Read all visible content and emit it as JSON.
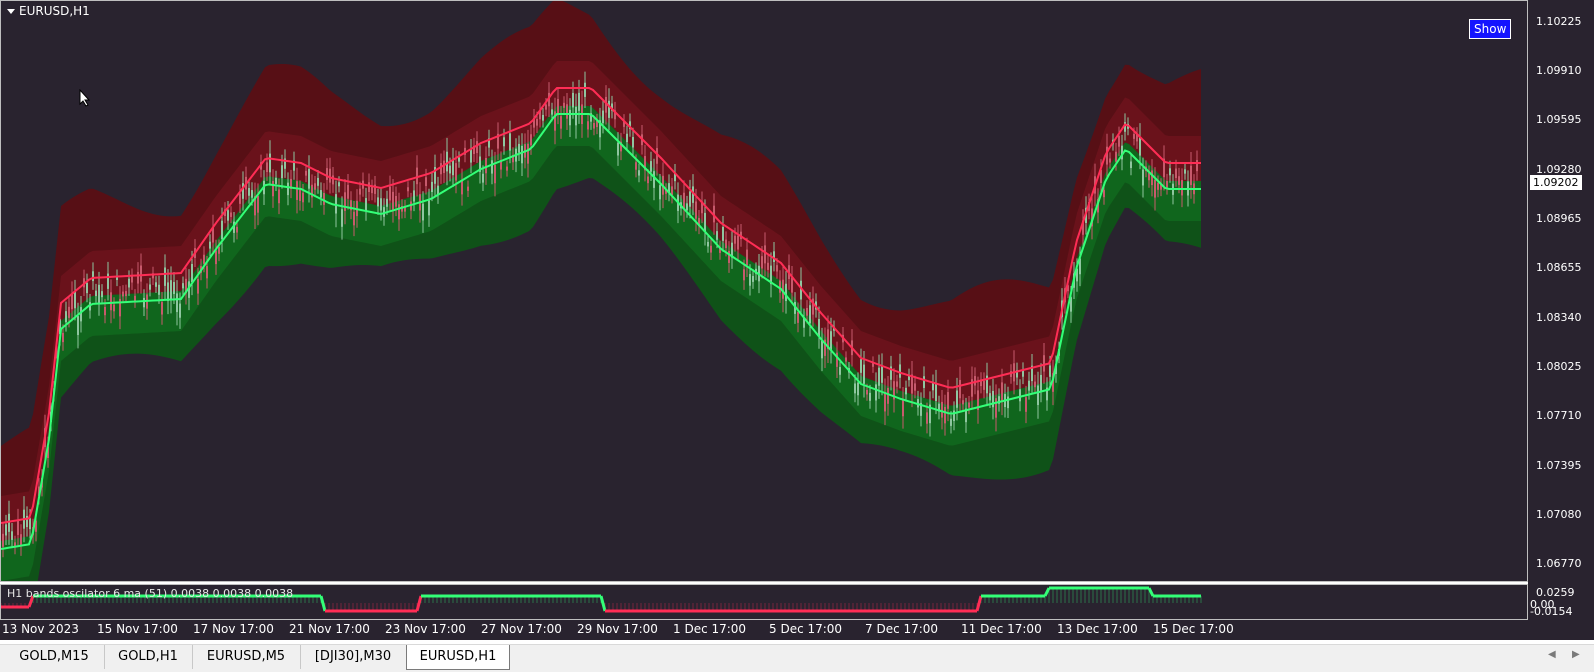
{
  "chart": {
    "symbol": "EURUSD,H1",
    "show_button": "Show",
    "current_price": "1.09202",
    "price_ticks": [
      "1.10225",
      "1.09910",
      "1.09595",
      "1.09280",
      "1.08965",
      "1.08655",
      "1.08340",
      "1.08025",
      "1.07710",
      "1.07395",
      "1.07080",
      "1.06770"
    ],
    "osc_label": "H1 bands oscilator 6 ma (51)  0.0038 0.0038 0.0038",
    "osc_ticks": [
      "0.0259",
      "0.00",
      "-0.0154"
    ],
    "time_labels": [
      "13 Nov 2023",
      "15 Nov 17:00",
      "17 Nov 17:00",
      "21 Nov 17:00",
      "23 Nov 17:00",
      "27 Nov 17:00",
      "29 Nov 17:00",
      "1 Dec 17:00",
      "5 Dec 17:00",
      "7 Dec 17:00",
      "11 Dec 17:00",
      "13 Dec 17:00",
      "15 Dec 17:00"
    ],
    "colors": {
      "background": "#29232f",
      "upper_band": "#5a0f14",
      "lower_band": "#0b5a14",
      "upper_line": "#ff2d55",
      "lower_line": "#33ff77",
      "candle_up": "#8fc6a0",
      "candle_down": "#c75a6c"
    }
  },
  "tabs": [
    {
      "label": "GOLD,M15",
      "active": false
    },
    {
      "label": "GOLD,H1",
      "active": false
    },
    {
      "label": "EURUSD,M5",
      "active": false
    },
    {
      "label": "[DJI30],M30",
      "active": false
    },
    {
      "label": "EURUSD,H1",
      "active": true
    }
  ],
  "icons": [
    "dropdown-triangle-icon",
    "mouse-cursor-icon",
    "scroll-left-icon",
    "scroll-right-icon"
  ]
}
